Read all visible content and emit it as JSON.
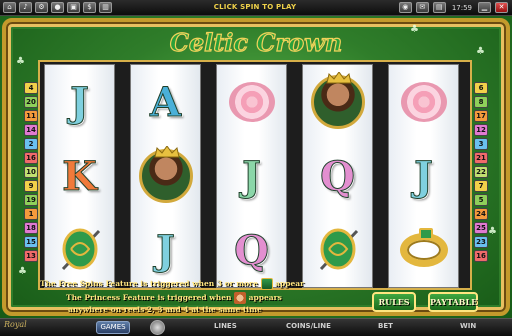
{
  "topbar": {
    "prompt": "CLICK SPIN TO PLAY",
    "clock": "17:59",
    "left_icons": [
      "home-icon",
      "sound-icon",
      "settings-icon",
      "chip-icon",
      "cash-icon",
      "dollar-icon",
      "graph-icon"
    ],
    "right_icons": [
      "coin-icon",
      "message-icon",
      "stats-icon",
      "minimize-icon",
      "close-icon"
    ]
  },
  "game": {
    "title": "Celtic Crown",
    "lines_left": [
      "4",
      "20",
      "11",
      "14",
      "2",
      "16",
      "10",
      "9",
      "19",
      "1",
      "18",
      "15",
      "13"
    ],
    "lines_right": [
      "6",
      "8",
      "17",
      "12",
      "3",
      "21",
      "22",
      "7",
      "5",
      "24",
      "25",
      "23",
      "16"
    ],
    "reels": [
      [
        {
          "type": "letter",
          "value": "J",
          "color": "#7fd0df"
        },
        {
          "type": "letter",
          "value": "K",
          "color": "#f07a3a"
        },
        {
          "type": "shield"
        }
      ],
      [
        {
          "type": "letter",
          "value": "A",
          "color": "#4ab0d8"
        },
        {
          "type": "king"
        },
        {
          "type": "letter",
          "value": "J",
          "color": "#7fd0df"
        }
      ],
      [
        {
          "type": "rose"
        },
        {
          "type": "letter",
          "value": "J",
          "color": "#8bd6a8"
        },
        {
          "type": "letter",
          "value": "Q",
          "color": "#e38fd0"
        }
      ],
      [
        {
          "type": "king"
        },
        {
          "type": "letter",
          "value": "Q",
          "color": "#e38fd0"
        },
        {
          "type": "shield"
        }
      ],
      [
        {
          "type": "rose"
        },
        {
          "type": "letter",
          "value": "J",
          "color": "#7fd0df"
        },
        {
          "type": "ring"
        }
      ]
    ],
    "info_line1_a": "The Free Spins Feature is triggered when 3 or more",
    "info_line1_b": "appear",
    "info_line2_a": "The Princess Feature is triggered when",
    "info_line2_b": "appears",
    "info_line3": "anywhere on reels 2, 3 and 4 at the same time",
    "rules_label": "RULES",
    "paytable_label": "PAYTABLE"
  },
  "bottom": {
    "games_label": "GAMES",
    "lines_label": "LINES",
    "coins_label": "COINS/LINE",
    "bet_label": "BET",
    "win_label": "WIN"
  }
}
